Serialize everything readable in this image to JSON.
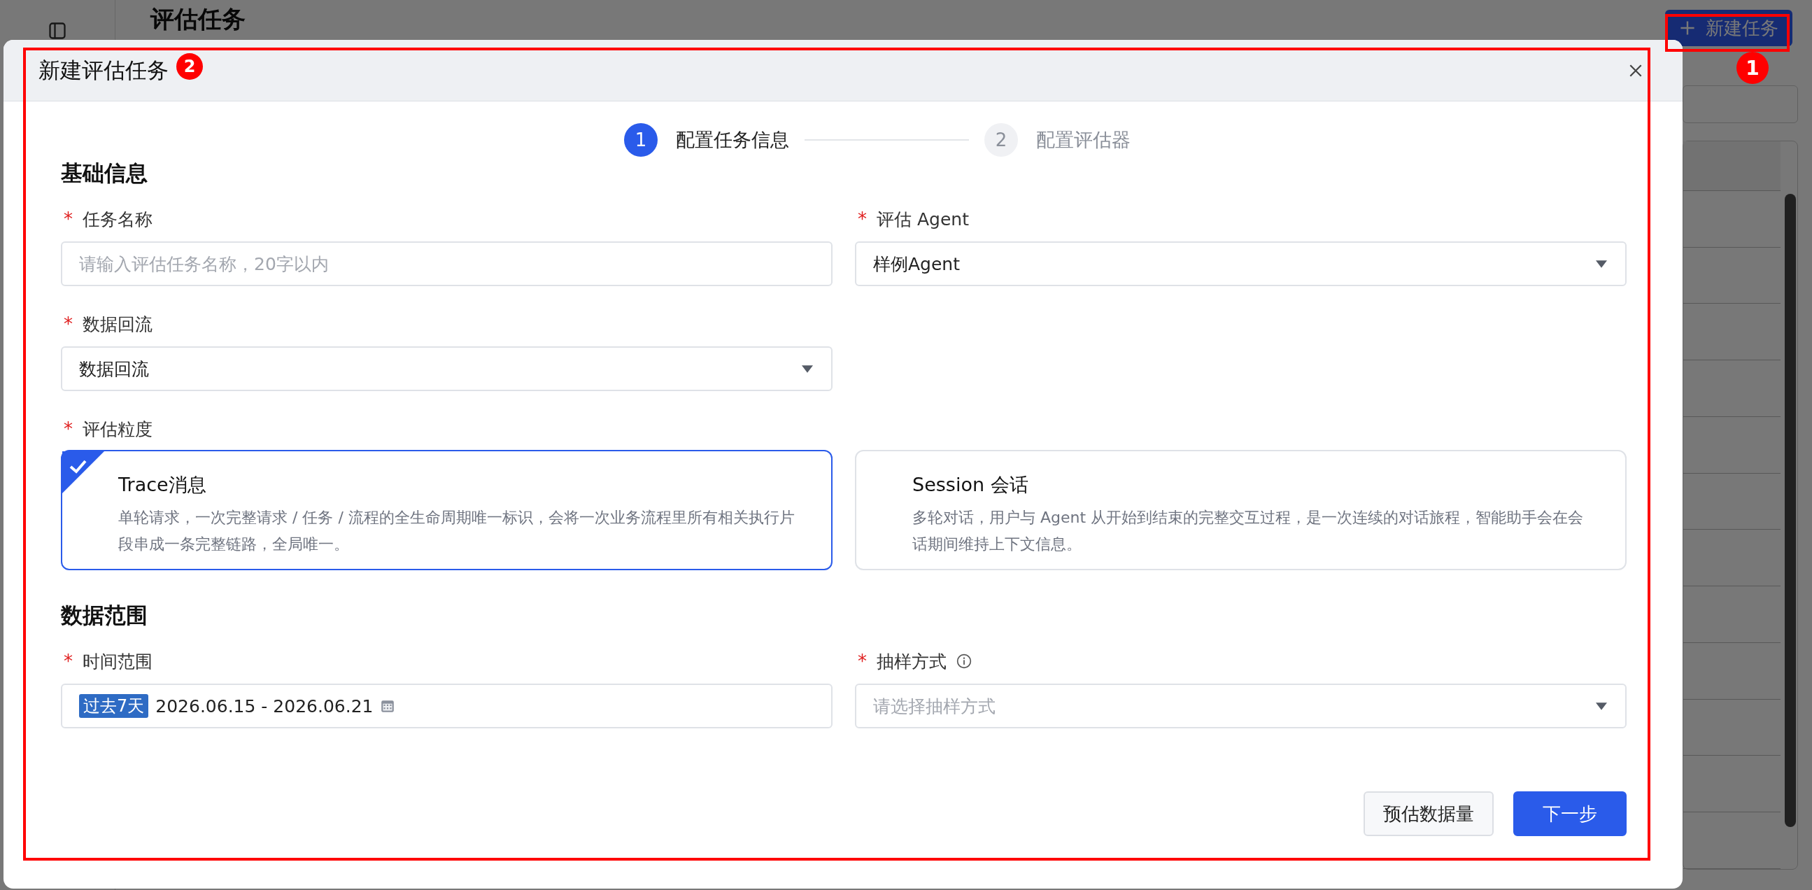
{
  "page": {
    "title": "评估任务",
    "new_button": "新建任务"
  },
  "annotations": [
    {
      "number": "2",
      "kind": "dialog"
    },
    {
      "number": "1",
      "kind": "button"
    }
  ],
  "dialog": {
    "title": "新建评估任务",
    "steps": [
      {
        "number": "1",
        "label": "配置任务信息",
        "selected": true
      },
      {
        "number": "2",
        "label": "配置评估器",
        "selected": false
      }
    ],
    "sections": [
      {
        "title": "基础信息",
        "fields": [
          {
            "kind": "input",
            "label": "任务名称",
            "required_mark": "*",
            "placeholder": "请输入评估任务名称，20字以内"
          },
          {
            "kind": "select",
            "label": "评估 Agent",
            "required_mark": "*",
            "value": "样例Agent"
          },
          {
            "kind": "select",
            "label": "数据回流",
            "required_mark": "*",
            "value": "数据回流"
          },
          {
            "kind": "cards",
            "label": "评估粒度",
            "required_mark": "*",
            "options": [
              {
                "title": "Trace消息",
                "description": "单轮请求，一次完整请求 / 任务 / 流程的全生命周期唯一标识，会将一次业务流程里所有相关执行片段串成一条完整链路，全局唯一。",
                "selected": true
              },
              {
                "title": "Session 会话",
                "description": "多轮对话，用户与 Agent 从开始到结束的完整交互过程，是一次连续的对话旅程，智能助手会在会话期间维持上下文信息。",
                "selected": false
              }
            ]
          }
        ]
      },
      {
        "title": "数据范围",
        "fields": [
          {
            "kind": "daterange",
            "label": "时间范围",
            "required_mark": "*",
            "tag": "过去7天",
            "value": "2026.06.15 - 2026.06.21"
          },
          {
            "kind": "select",
            "label": "抽样方式",
            "required_mark": "*",
            "info": true,
            "placeholder": "请选择抽样方式"
          }
        ]
      }
    ],
    "buttons": [
      {
        "label": "预估数据量",
        "primary": false
      },
      {
        "label": "下一步",
        "primary": true
      }
    ]
  }
}
